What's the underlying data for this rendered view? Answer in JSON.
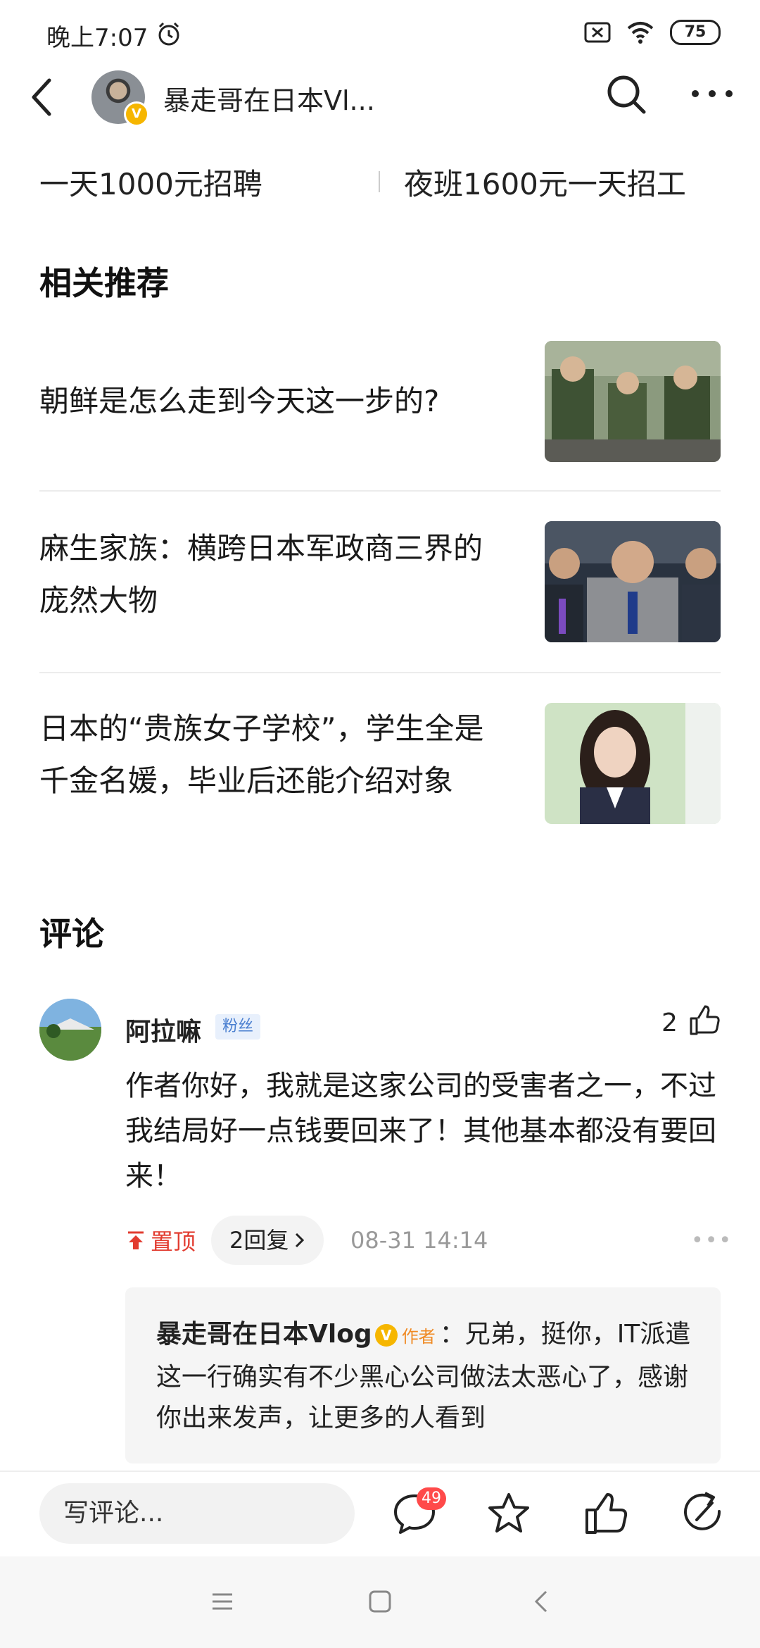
{
  "status_bar": {
    "time": "晚上7:07",
    "battery": "75"
  },
  "header": {
    "title": "暴走哥在日本Vl..."
  },
  "hot_searches": [
    "一天1000元招聘",
    "夜班1600元一天招工"
  ],
  "related": {
    "title": "相关推荐",
    "items": [
      {
        "text": "朝鲜是怎么走到今天这一步的?"
      },
      {
        "text": "麻生家族：横跨日本军政商三界的庞然大物"
      },
      {
        "text": "日本的“贵族女子学校”，学生全是千金名媛，毕业后还能介绍对象"
      }
    ]
  },
  "comments": {
    "title": "评论",
    "items": [
      {
        "name": "阿拉嘛",
        "badge": "粉丝",
        "likes": "2",
        "text": "作者你好，我就是这家公司的受害者之一，不过我结局好一点钱要回来了！其他基本都没有要回来！",
        "pinned_label": "置顶",
        "replies_label": "2回复",
        "time": "08-31 14:14",
        "reply": {
          "author": "暴走哥在日本Vlog",
          "author_tag": "作者",
          "text": "：兄弟，挺你，IT派遣这一行确实有不少黑心公司做法太恶心了，感谢你出来发声，让更多的人看到"
        }
      }
    ]
  },
  "bottom_bar": {
    "input_placeholder": "写评论...",
    "comment_count": "49"
  }
}
